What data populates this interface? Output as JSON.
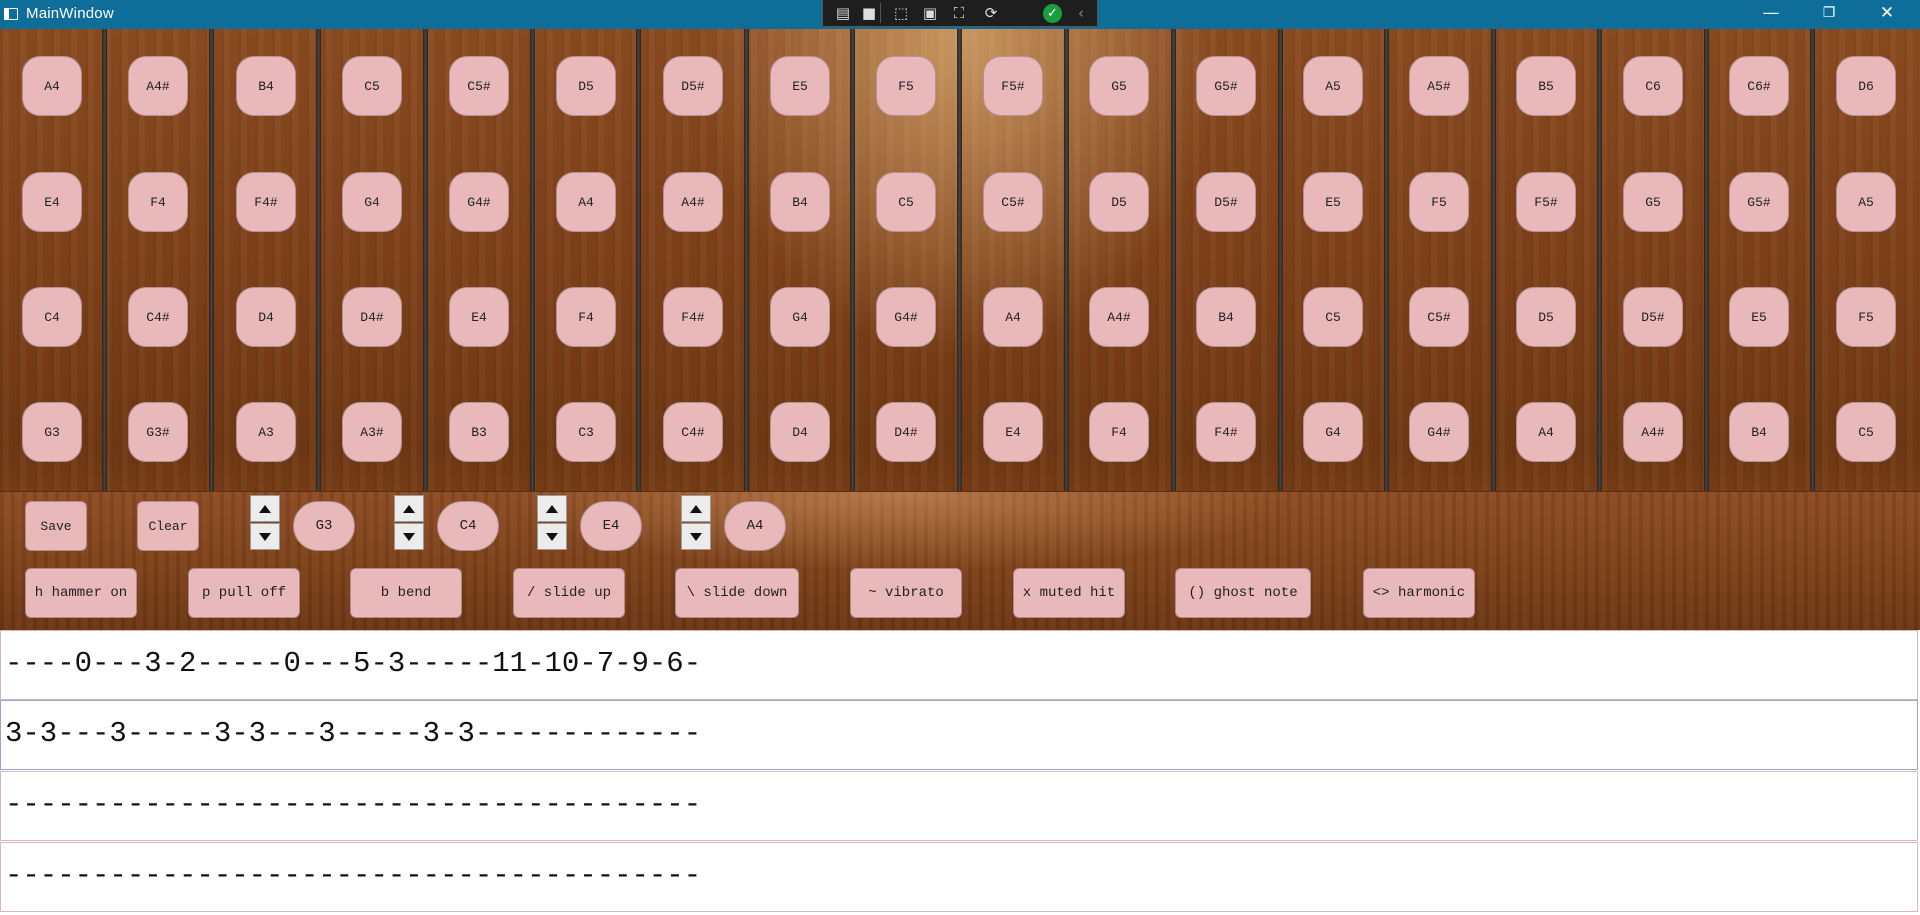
{
  "window": {
    "title": "MainWindow"
  },
  "colors": {
    "titlebar": "#0f6e99",
    "note_fill": "#e8b8ba",
    "wood": "#7d4019"
  },
  "fretboard": {
    "rows": [
      [
        "A4",
        "A4#",
        "B4",
        "C5",
        "C5#",
        "D5",
        "D5#",
        "E5",
        "F5",
        "F5#",
        "G5",
        "G5#",
        "A5",
        "A5#",
        "B5",
        "C6",
        "C6#",
        "D6"
      ],
      [
        "E4",
        "F4",
        "F4#",
        "G4",
        "G4#",
        "A4",
        "A4#",
        "B4",
        "C5",
        "C5#",
        "D5",
        "D5#",
        "E5",
        "F5",
        "F5#",
        "G5",
        "G5#",
        "A5"
      ],
      [
        "C4",
        "C4#",
        "D4",
        "D4#",
        "E4",
        "F4",
        "F4#",
        "G4",
        "G4#",
        "A4",
        "A4#",
        "B4",
        "C5",
        "C5#",
        "D5",
        "D5#",
        "E5",
        "F5"
      ],
      [
        "G3",
        "G3#",
        "A3",
        "A3#",
        "B3",
        "C3",
        "C4#",
        "D4",
        "D4#",
        "E4",
        "F4",
        "F4#",
        "G4",
        "G4#",
        "A4",
        "A4#",
        "B4",
        "C5"
      ]
    ]
  },
  "controls": {
    "save": "Save",
    "clear": "Clear",
    "tuning": [
      "G3",
      "C4",
      "E4",
      "A4"
    ]
  },
  "techniques": [
    "h hammer on",
    "p pull off",
    "b bend",
    "/ slide up",
    "\\ slide down",
    "~ vibrato",
    "x muted hit",
    "() ghost note",
    "<> harmonic"
  ],
  "tab_lines": [
    "----0---3-2-----0---5-3-----11-10-7-9-6-",
    "3-3---3-----3-3---3-----3-3-------------",
    "----------------------------------------",
    "----------------------------------------"
  ]
}
